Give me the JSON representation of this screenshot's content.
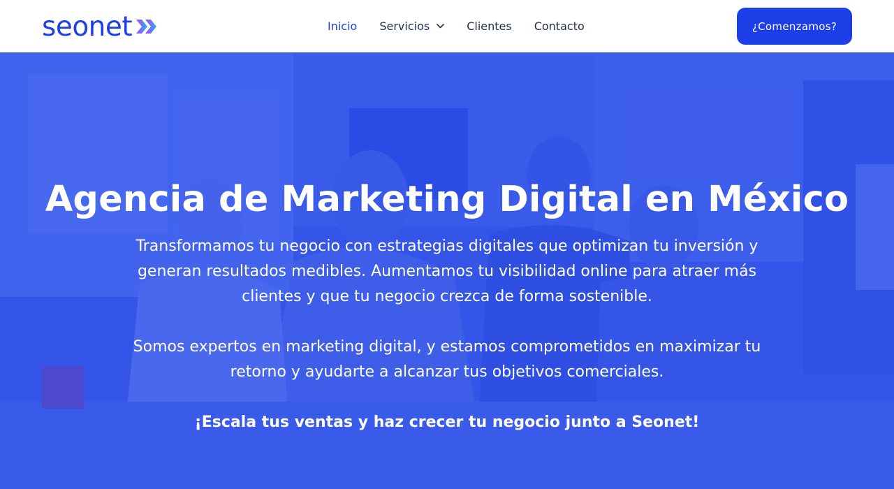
{
  "brand": {
    "name": "seonet",
    "colors": {
      "primary": "#1d3fe8",
      "mark_start": "#b53bf0",
      "mark_end": "#1fb8f2",
      "nav_text": "#253050"
    }
  },
  "nav": {
    "items": [
      {
        "label": "Inicio",
        "active": true
      },
      {
        "label": "Servicios",
        "active": false,
        "dropdown": true
      },
      {
        "label": "Clientes",
        "active": false
      },
      {
        "label": "Contacto",
        "active": false
      }
    ]
  },
  "cta": {
    "label": "¿Comenzamos?"
  },
  "hero": {
    "title": "Agencia de Marketing Digital en México",
    "paragraph1": "Transformamos tu negocio con estrategias digitales que optimizan tu inversión y generan resultados medibles. Aumentamos tu visibilidad online para atraer más clientes y que tu negocio crezca de forma sostenible.",
    "paragraph2": "Somos expertos en marketing digital, y estamos comprometidos en maximizar tu retorno y ayudarte a alcanzar tus objetivos comerciales.",
    "tagline": "¡Escala tus ventas y haz crecer tu negocio junto a Seonet!",
    "overlay_color": "#2448f0"
  },
  "icons": {
    "logo_mark": "double-chevron-right-icon",
    "dropdown": "chevron-down-icon"
  }
}
